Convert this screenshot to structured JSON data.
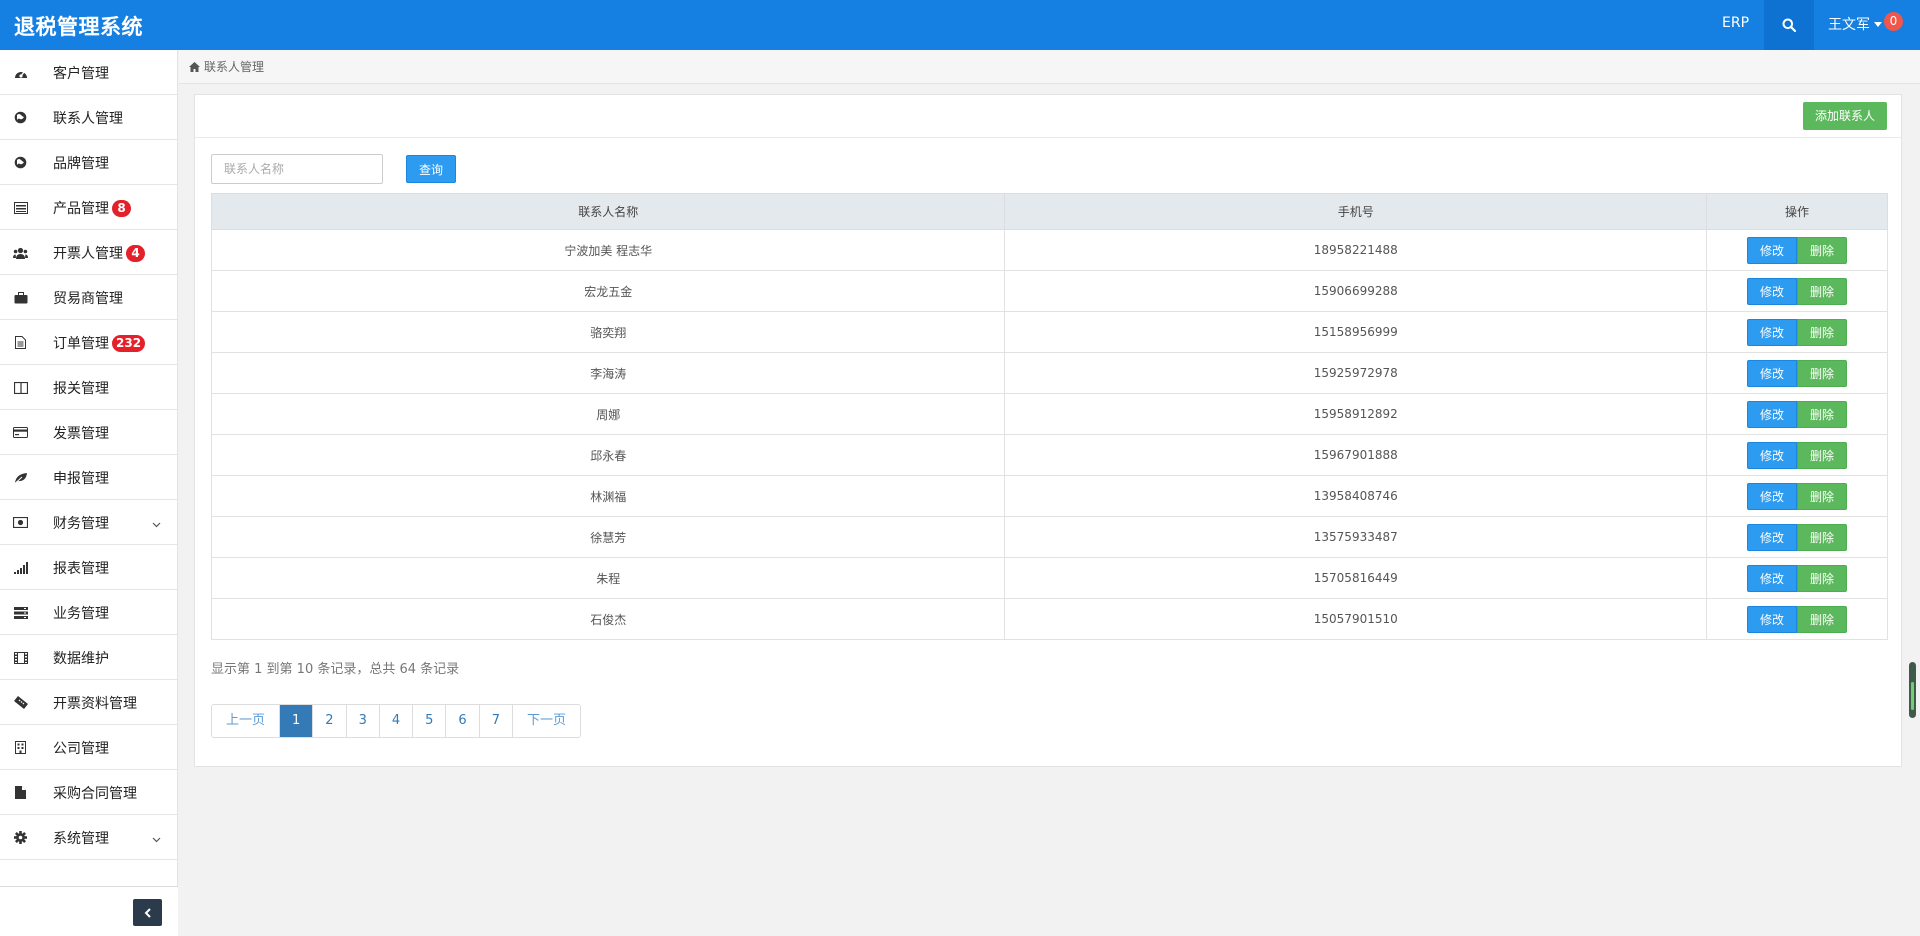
{
  "header": {
    "title": "退税管理系统",
    "erp_label": "ERP",
    "user_name": "王文军",
    "notification_count": "0"
  },
  "sidebar": {
    "items": [
      {
        "label": "客户管理",
        "icon": "dashboard-icon",
        "badge": ""
      },
      {
        "label": "联系人管理",
        "icon": "globe-icon",
        "badge": ""
      },
      {
        "label": "品牌管理",
        "icon": "globe-icon",
        "badge": ""
      },
      {
        "label": "产品管理",
        "icon": "list-icon",
        "badge": "8"
      },
      {
        "label": "开票人管理",
        "icon": "users-icon",
        "badge": "4"
      },
      {
        "label": "贸易商管理",
        "icon": "briefcase-icon",
        "badge": ""
      },
      {
        "label": "订单管理",
        "icon": "document-icon",
        "badge": "232"
      },
      {
        "label": "报关管理",
        "icon": "columns-icon",
        "badge": ""
      },
      {
        "label": "发票管理",
        "icon": "credit-card-icon",
        "badge": ""
      },
      {
        "label": "申报管理",
        "icon": "leaf-icon",
        "badge": ""
      },
      {
        "label": "财务管理",
        "icon": "money-icon",
        "badge": "",
        "expandable": true
      },
      {
        "label": "报表管理",
        "icon": "signal-icon",
        "badge": ""
      },
      {
        "label": "业务管理",
        "icon": "server-icon",
        "badge": ""
      },
      {
        "label": "数据维护",
        "icon": "film-icon",
        "badge": ""
      },
      {
        "label": "开票资料管理",
        "icon": "ticket-icon",
        "badge": ""
      },
      {
        "label": "公司管理",
        "icon": "building-icon",
        "badge": ""
      },
      {
        "label": "采购合同管理",
        "icon": "file-icon",
        "badge": ""
      },
      {
        "label": "系统管理",
        "icon": "gear-icon",
        "badge": "",
        "expandable": true
      }
    ]
  },
  "breadcrumb": {
    "label": "联系人管理"
  },
  "toolbar": {
    "add_label": "添加联系人",
    "search_placeholder": "联系人名称",
    "query_label": "查询"
  },
  "table": {
    "headers": [
      "联系人名称",
      "手机号",
      "操作"
    ],
    "edit_label": "修改",
    "delete_label": "删除",
    "rows": [
      {
        "name": "宁波加美 程志华",
        "phone": "18958221488"
      },
      {
        "name": "宏龙五金",
        "phone": "15906699288"
      },
      {
        "name": "骆奕翔",
        "phone": "15158956999"
      },
      {
        "name": "李海涛",
        "phone": "15925972978"
      },
      {
        "name": "周娜",
        "phone": "15958912892"
      },
      {
        "name": "邱永春",
        "phone": "15967901888"
      },
      {
        "name": "林渊福",
        "phone": "13958408746"
      },
      {
        "name": "徐慧芳",
        "phone": "13575933487"
      },
      {
        "name": "朱程",
        "phone": "15705816449"
      },
      {
        "name": "石俊杰",
        "phone": "15057901510"
      }
    ]
  },
  "pagination": {
    "summary": "显示第 1 到第 10 条记录，总共 64 条记录",
    "prev_label": "上一页",
    "next_label": "下一页",
    "pages": [
      "1",
      "2",
      "3",
      "4",
      "5",
      "6",
      "7"
    ],
    "current": "1"
  },
  "colors": {
    "header_blue": "#1580e2",
    "primary_button": "#2d9bf0",
    "success_button": "#5cb85c",
    "badge_red": "#e4212a"
  }
}
